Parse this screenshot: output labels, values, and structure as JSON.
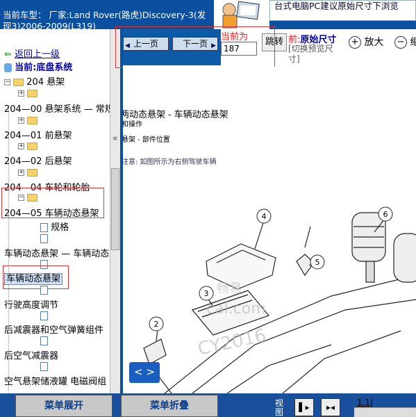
{
  "header": {
    "vehicle_line1": "当前车型：  厂家:Land Rover(路虎)Discovery-3(发",
    "vehicle_line2": "现3)2006-2009(L319)",
    "notice": "台式电脑PC建议原始尺寸下浏览"
  },
  "tree": {
    "back": "返回上一级",
    "current": "当前:底盘系统",
    "items": [
      {
        "label": "204 悬架"
      },
      {
        "label": "204—00 悬架系统 — 常规"
      },
      {
        "label": "204—01 前悬架"
      },
      {
        "label": "204—02 后悬架"
      },
      {
        "label": "204—04 车轮和轮胎"
      },
      {
        "label": "204—05 车辆动态悬架"
      },
      {
        "label": "规格"
      },
      {
        "label": "车辆动态悬架 — 车辆动态"
      },
      {
        "label": "车辆动态悬架"
      },
      {
        "label": "行驶高度调节"
      },
      {
        "label": "后减震器和空气弹簧组件"
      },
      {
        "label": "后空气减震器"
      },
      {
        "label": "空气悬架储液罐 电磁阀组"
      }
    ]
  },
  "toolbar": {
    "prev": "上一页",
    "next": "下一页",
    "current_label": "当前为",
    "page_value": "187",
    "go": "跳转",
    "size_prefix": "前:",
    "size_title": "原始尺寸",
    "size_sub": "[切换预览尺寸]",
    "zoom_in": "放大",
    "zoom_out": "缩"
  },
  "document": {
    "heading": "两动态悬架 - 车辆动态悬架",
    "sub": "和操作",
    "section": "悬架 - 部件位置",
    "note": "注意:  如图所示为右侧驾驶车辆",
    "callouts": [
      "4",
      "6",
      "5",
      "3",
      "2"
    ],
    "watermarks": [
      "畅易",
      "cal.com",
      "CY2016"
    ],
    "arrows": "< >"
  },
  "bottom": {
    "expand": "菜单展开",
    "collapse": "菜单折叠",
    "view": "视图",
    "page_num": "1.1|"
  },
  "colors": {
    "header_blue": "#0a4fa0",
    "highlight_red": "#e53535",
    "link_blue": "#0000aa"
  }
}
